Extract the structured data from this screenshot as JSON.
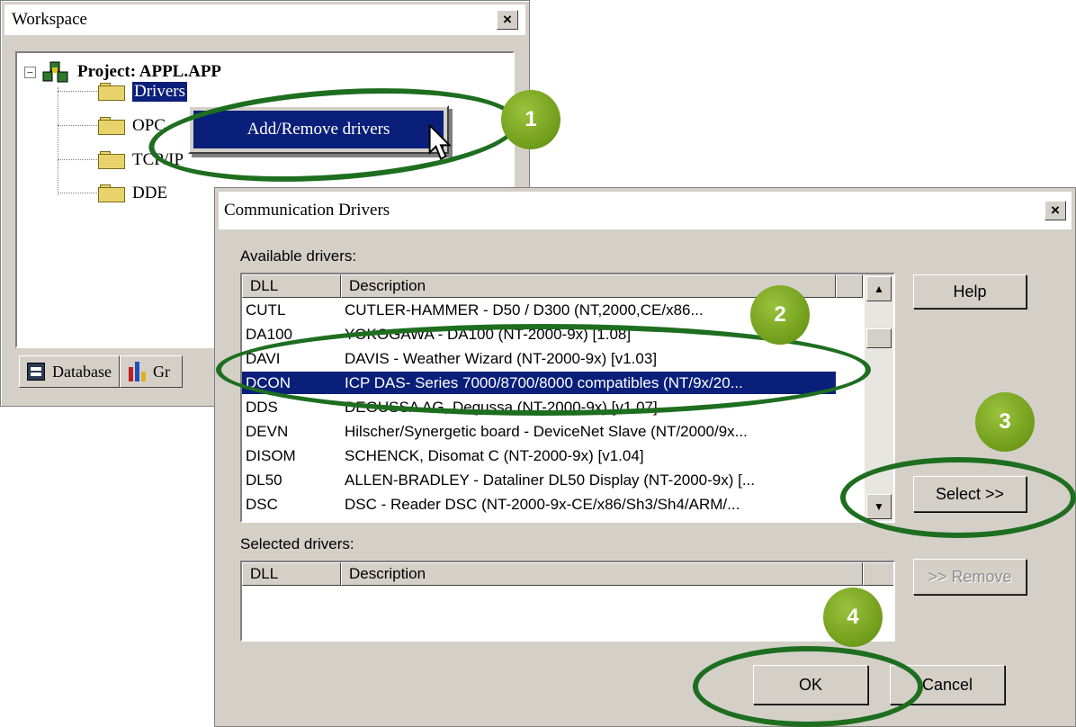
{
  "workspace": {
    "title": "Workspace",
    "project_label": "Project: APPL.APP",
    "tree_items": [
      "Drivers",
      "OPC",
      "TCP/IP",
      "DDE"
    ],
    "tabs": [
      "Database",
      "Gr"
    ]
  },
  "context_menu": {
    "item_label": "Add/Remove drivers"
  },
  "dialog": {
    "title": "Communication Drivers",
    "available_label": "Available drivers:",
    "selected_label": "Selected drivers:",
    "col_dll": "DLL",
    "col_description": "Description",
    "available_rows": [
      {
        "dll": "CUTL",
        "description": "CUTLER-HAMMER - D50 / D300 (NT,2000,CE/x86..."
      },
      {
        "dll": "DA100",
        "description": "YOKOGAWA - DA100 (NT-2000-9x) [1.08]"
      },
      {
        "dll": "DAVI",
        "description": "DAVIS - Weather Wizard (NT-2000-9x) [v1.03]"
      },
      {
        "dll": "DCON",
        "description": "ICP DAS- Series 7000/8700/8000 compatibles (NT/9x/20..."
      },
      {
        "dll": "DDS",
        "description": "DEGUSSA AG, Degussa (NT-2000-9x) [v1.07]"
      },
      {
        "dll": "DEVN",
        "description": "Hilscher/Synergetic board - DeviceNet Slave (NT/2000/9x..."
      },
      {
        "dll": "DISOM",
        "description": "SCHENCK, Disomat C (NT-2000-9x) [v1.04]"
      },
      {
        "dll": "DL50",
        "description": "ALLEN-BRADLEY - Dataliner DL50 Display (NT-2000-9x) [..."
      },
      {
        "dll": "DSC",
        "description": "DSC  - Reader DSC (NT-2000-9x-CE/x86/Sh3/Sh4/ARM/..."
      }
    ],
    "selected_row_index": 3,
    "buttons": {
      "help": "Help",
      "select": "Select >>",
      "remove": ">> Remove",
      "ok": "OK",
      "cancel": "Cancel"
    }
  },
  "callouts": [
    "1",
    "2",
    "3",
    "4"
  ],
  "colors": {
    "callout_green": "#6f9c1a",
    "ellipse_green": "#1e6e20",
    "selection_blue": "#0a1f7a"
  }
}
